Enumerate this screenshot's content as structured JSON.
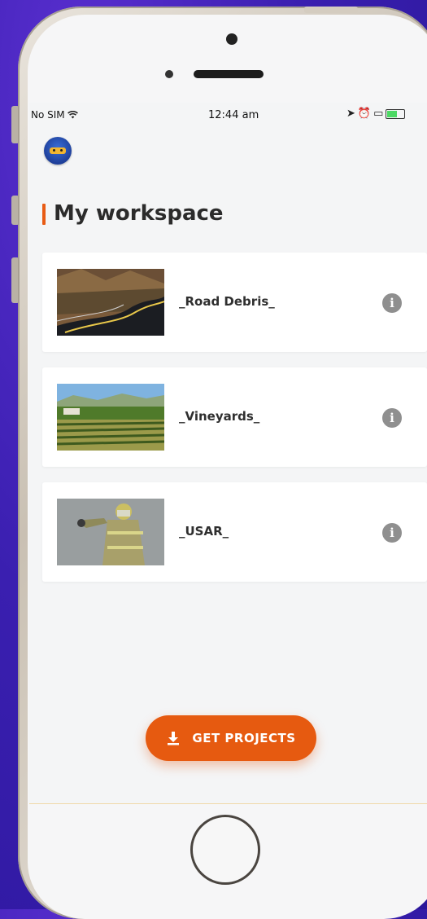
{
  "status": {
    "carrier": "No SIM",
    "time": "12:44 am"
  },
  "header": {
    "title": "My workspace"
  },
  "projects": [
    {
      "name": "_Road Debris_",
      "thumb": "road-image"
    },
    {
      "name": "_Vineyards_",
      "thumb": "vineyard-image"
    },
    {
      "name": "_USAR_",
      "thumb": "firefighter-image"
    }
  ],
  "actions": {
    "get_projects_label": "GET PROJECTS"
  },
  "colors": {
    "accent": "#e65a10",
    "background": "#f4f5f6",
    "card": "#ffffff",
    "info": "#8f8f8f"
  },
  "icons": {
    "info": "info-icon",
    "download": "download-icon",
    "wifi": "wifi-icon",
    "location": "location-arrow-icon",
    "alarm": "alarm-icon",
    "battery": "battery-icon"
  }
}
